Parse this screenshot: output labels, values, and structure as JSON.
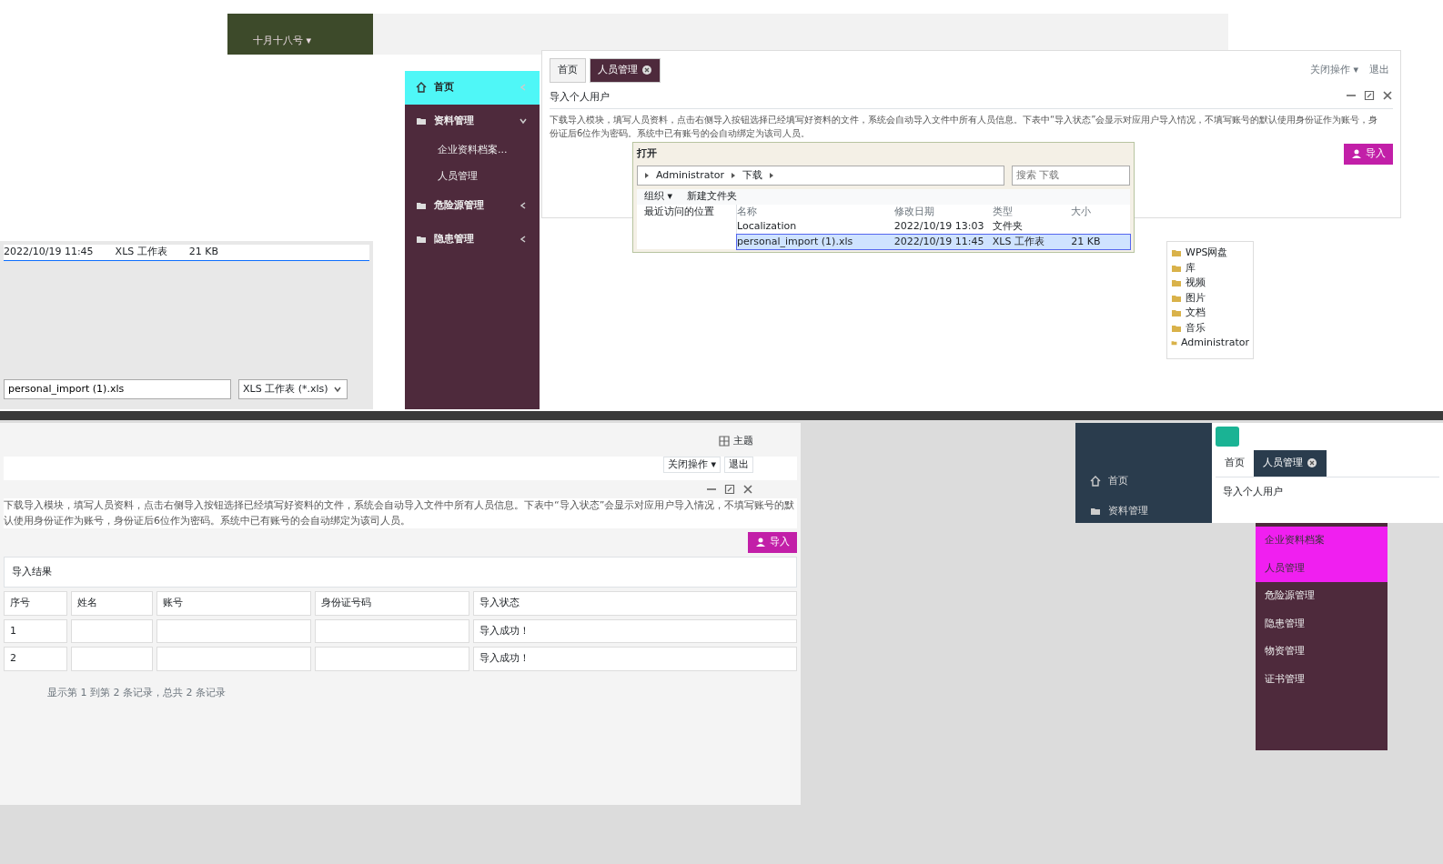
{
  "top_bar": {
    "date_menu": "十月十八号 ▾"
  },
  "sidebar": {
    "items": [
      {
        "label": "首页",
        "selected": true,
        "expanded": false
      },
      {
        "label": "资料管理",
        "selected": false,
        "expanded": true,
        "children": [
          {
            "label": "企业资料档案..."
          },
          {
            "label": "人员管理"
          }
        ]
      },
      {
        "label": "危险源管理",
        "selected": false,
        "expanded": false
      },
      {
        "label": "隐患管理",
        "selected": false,
        "expanded": false
      }
    ]
  },
  "main": {
    "tabs": [
      {
        "label": "首页",
        "selected": false
      },
      {
        "label": "人员管理",
        "selected": true
      }
    ],
    "actions": [
      "关闭操作 ▾",
      "退出"
    ],
    "title": "导入个人用户",
    "description": "下载导入模块，填写人员资料，点击右侧导入按钮选择已经填写好资料的文件，系统会自动导入文件中所有人员信息。下表中“导入状态”会显示对应用户导入情况，不填写账号的默认使用身份证作为账号，身份证后6位作为密码。系统中已有账号的会自动绑定为该司人员。",
    "import_button": "导入"
  },
  "open_dialog": {
    "title": "打开",
    "path": [
      "Administrator",
      "下载"
    ],
    "search": {
      "placeholder": "搜索 下载"
    },
    "toolbar": [
      "组织 ▾",
      "新建文件夹"
    ],
    "nav": [
      "最近访问的位置"
    ],
    "columns": [
      "名称",
      "修改日期",
      "类型",
      "大小"
    ],
    "files": [
      {
        "name": "Localization",
        "date": "2022/10/19 13:03",
        "type": "文件夹",
        "selected": false
      },
      {
        "name": "personal_import (1).xls",
        "date": "2022/10/19 11:45",
        "type": "XLS 工作表",
        "size": "21 KB",
        "selected": true
      }
    ]
  },
  "nav_tree": [
    "WPS网盘",
    "库",
    "视频",
    "图片",
    "文档",
    "音乐",
    "Administrator"
  ],
  "file_fragment": {
    "row": [
      "2022/10/19 11:45",
      "XLS 工作表",
      "21 KB"
    ],
    "filename": "personal_import (1).xls",
    "filter": "XLS 工作表 (*.xls)"
  },
  "result_panel": {
    "theme": "主题",
    "actions": [
      "关闭操作 ▾",
      "退出"
    ],
    "description": "下载导入模块，填写人员资料，点击右侧导入按钮选择已经填写好资料的文件，系统会自动导入文件中所有人员信息。下表中“导入状态”会显示对应用户导入情况，不填写账号的默认使用身份证作为账号，身份证后6位作为密码。系统中已有账号的会自动绑定为该司人员。",
    "import_button": "导入",
    "section_title": "导入结果",
    "columns": [
      "序号",
      "姓名",
      "账号",
      "身份证号码",
      "导入状态"
    ],
    "rows": [
      {
        "index": "1",
        "status": "导入成功！"
      },
      {
        "index": "2",
        "status": "导入成功！"
      }
    ],
    "footer": "显示第 1 到第 2 条记录，总共 2 条记录"
  },
  "mini_app": {
    "sidebar": [
      {
        "label": "首页",
        "selected": false
      },
      {
        "label": "资料管理",
        "selected": false
      }
    ],
    "tabs": [
      {
        "label": "首页",
        "selected": false
      },
      {
        "label": "人员管理",
        "selected": true
      }
    ],
    "title": "导入个人用户"
  },
  "menu_fragment": {
    "items": [
      {
        "label": "企业资料档案",
        "selected": true
      },
      {
        "label": "人员管理",
        "selected": true
      },
      {
        "label": "危险源管理",
        "selected": false
      },
      {
        "label": "隐患管理",
        "selected": false
      },
      {
        "label": "物资管理",
        "selected": false
      },
      {
        "label": "证书管理",
        "selected": false
      }
    ]
  }
}
